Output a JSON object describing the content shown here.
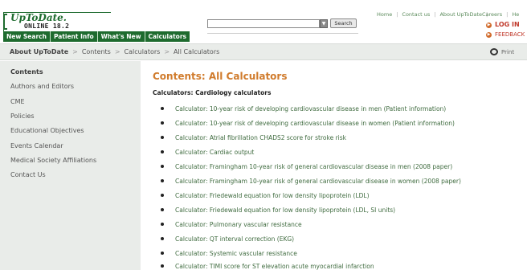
{
  "header": {
    "logo_title": "UpToDate.",
    "logo_sub": "ONLINE 18.2",
    "nav": [
      "New Search",
      "Patient Info",
      "What's New",
      "Calculators"
    ],
    "search_button": "Search",
    "search_value": "",
    "top_links": [
      "Home",
      "Contact us",
      "About UpToDate"
    ],
    "right_links": [
      "Careers",
      "He"
    ],
    "login": "LOG IN",
    "feedback": "FEEDBACK"
  },
  "breadcrumb": {
    "root": "About UpToDate",
    "items": [
      "Contents",
      "Calculators",
      "All Calculators"
    ],
    "print": "Print"
  },
  "sidebar": {
    "items": [
      "Contents",
      "Authors and Editors",
      "CME",
      "Policies",
      "Educational Objectives",
      "Events Calendar",
      "Medical Society Affiliations",
      "Contact Us"
    ]
  },
  "main": {
    "title": "Contents: All Calculators",
    "section": "Calculators: Cardiology calculators",
    "calculators": [
      "Calculator: 10-year risk of developing cardiovascular disease in men (Patient information)",
      "Calculator: 10-year risk of developing cardiovascular disease in women (Patient information)",
      "Calculator: Atrial fibrillation CHADS2 score for stroke risk",
      "Calculator: Cardiac output",
      "Calculator: Framingham 10-year risk of general cardiovascular disease in men (2008 paper)",
      "Calculator: Framingham 10-year risk of general cardiovascular disease in women (2008 paper)",
      "Calculator: Friedewald equation for low density lipoprotein (LDL)",
      "Calculator: Friedewald equation for low density lipoprotein (LDL, SI units)",
      "Calculator: Pulmonary vascular resistance",
      "Calculator: QT interval correction (EKG)",
      "Calculator: Systemic vascular resistance",
      "Calculator: TIMI score for ST elevation acute myocardial infarction"
    ]
  },
  "colors": {
    "brand_green": "#1e6b2e",
    "title_orange": "#d07b2c",
    "link_green": "#3f6b3f",
    "alert_red": "#c0392b"
  },
  "icons": [
    "dropdown-arrow-icon",
    "bullet-arrow-icon",
    "print-icon"
  ]
}
